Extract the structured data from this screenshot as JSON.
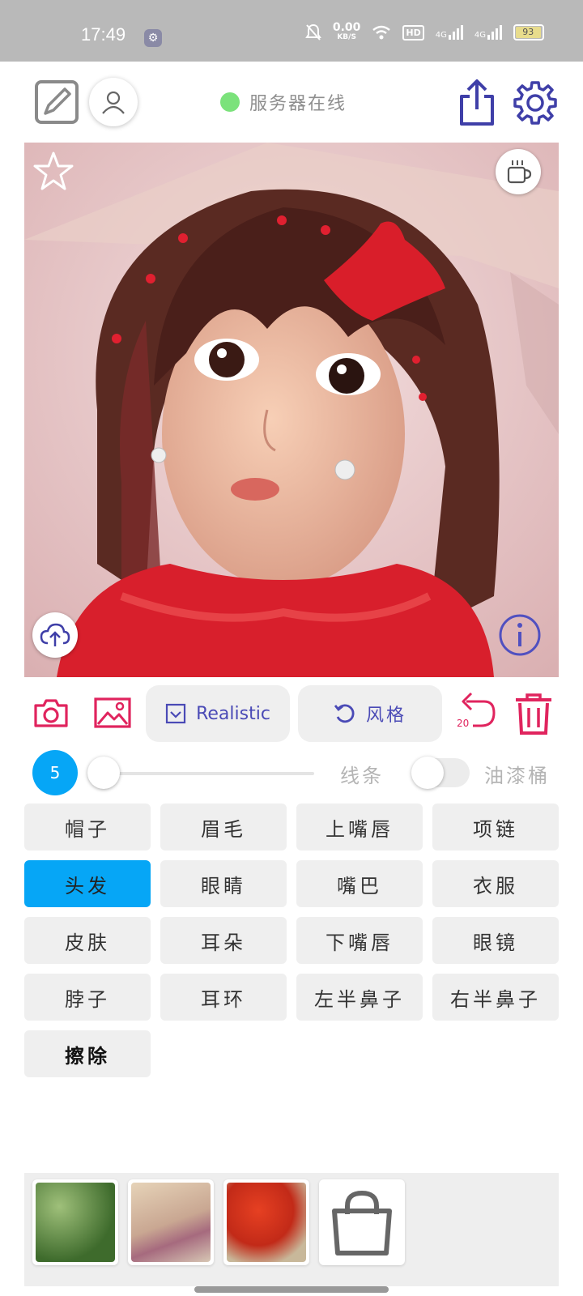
{
  "status_bar": {
    "time": "17:49",
    "net_speed": "0.00",
    "net_unit": "KB/S",
    "hd": "HD",
    "sim1": "4G",
    "sim2": "4G",
    "battery": "93"
  },
  "toolbar": {
    "edit_icon": "edit-pen-icon",
    "profile_icon": "user-icon",
    "server_status_label": "服务器在线",
    "server_status_color": "#7be27b",
    "share_icon": "share-upload-icon",
    "settings_icon": "gear-icon"
  },
  "canvas": {
    "favorite_icon": "star-icon",
    "cup_icon": "coffee-cup-icon",
    "upload_icon": "cloud-upload-icon",
    "info_icon": "info-icon"
  },
  "edit_bar": {
    "camera_icon": "camera-icon",
    "gallery_icon": "image-icon",
    "model_label": "Realistic",
    "style_label": "风格",
    "undo_count": "20",
    "delete_icon": "trash-icon",
    "accent_color": "#e0245e",
    "pill_text_color": "#4a4ab6"
  },
  "brush": {
    "size": "5",
    "slider_fraction": 0.0,
    "line_label": "线条",
    "bucket_label": "油漆桶",
    "bucket_enabled": false
  },
  "parts": [
    {
      "label": "帽子",
      "selected": false
    },
    {
      "label": "眉毛",
      "selected": false
    },
    {
      "label": "上嘴唇",
      "selected": false
    },
    {
      "label": "项链",
      "selected": false
    },
    {
      "label": "头发",
      "selected": true
    },
    {
      "label": "眼睛",
      "selected": false
    },
    {
      "label": "嘴巴",
      "selected": false
    },
    {
      "label": "衣服",
      "selected": false
    },
    {
      "label": "皮肤",
      "selected": false
    },
    {
      "label": "耳朵",
      "selected": false
    },
    {
      "label": "下嘴唇",
      "selected": false
    },
    {
      "label": "眼镜",
      "selected": false
    },
    {
      "label": "脖子",
      "selected": false
    },
    {
      "label": "耳环",
      "selected": false
    },
    {
      "label": "左半鼻子",
      "selected": false
    },
    {
      "label": "右半鼻子",
      "selected": false
    },
    {
      "label": "擦除",
      "selected": false
    }
  ],
  "selected_color": "#06a6f6",
  "tray": {
    "bag_icon": "shopping-bag-icon"
  }
}
